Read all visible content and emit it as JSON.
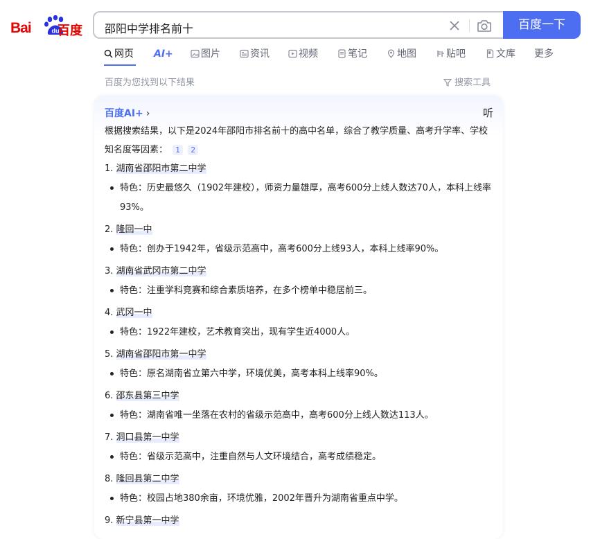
{
  "logo": {
    "bai": "Bai",
    "du": "du",
    "baidu": "百度"
  },
  "search": {
    "query": "邵阳中学排名前十",
    "button": "百度一下"
  },
  "tabs": [
    {
      "label": "网页"
    },
    {
      "label": "AI+"
    },
    {
      "label": "图片"
    },
    {
      "label": "资讯"
    },
    {
      "label": "视频"
    },
    {
      "label": "笔记"
    },
    {
      "label": "地图"
    },
    {
      "label": "贴吧"
    },
    {
      "label": "文库"
    },
    {
      "label": "更多"
    }
  ],
  "result_count": "百度为您找到以下结果",
  "search_tools": "搜索工具",
  "ai": {
    "brand": "百度AI+",
    "listen": "听",
    "intro": "根据搜索结果，以下是2024年邵阳市排名前十的高中名单，综合了教学质量、高考升学率、学校知名度等因素：",
    "refs": [
      "1",
      "2"
    ],
    "items": [
      {
        "num": "1.",
        "name": "湖南省邵阳市第二中学",
        "feat": "特色：历史最悠久（1902年建校），师资力量雄厚，高考600分上线人数达70人，本科上线率93%。"
      },
      {
        "num": "2.",
        "name": "隆回一中",
        "feat": "特色：创办于1942年，省级示范高中，高考600分上线93人，本科上线率90%。"
      },
      {
        "num": "3.",
        "name": "湖南省武冈市第二中学",
        "feat": "特色：注重学科竞赛和综合素质培养，在多个榜单中稳居前三。"
      },
      {
        "num": "4.",
        "name": "武冈一中",
        "feat": "特色：1922年建校，艺术教育突出，现有学生近4000人。"
      },
      {
        "num": "5.",
        "name": "湖南省邵阳市第一中学",
        "feat": "特色：原名湖南省立第六中学，环境优美，高考本科上线率90%。"
      },
      {
        "num": "6.",
        "name": "邵东县第三中学",
        "feat": "特色：湖南省唯一坐落在农村的省级示范高中，高考600分上线人数达113人。"
      },
      {
        "num": "7.",
        "name": "洞口县第一中学",
        "feat": "特色：省级示范高中，注重自然与人文环境结合，高考成绩稳定。"
      },
      {
        "num": "8.",
        "name": "隆回县第二中学",
        "feat": "特色：校园占地380余亩，环境优雅，2002年晋升为湖南省重点中学。"
      },
      {
        "num": "9.",
        "name": "新宁县第一中学",
        "feat": ""
      }
    ]
  },
  "colors": {
    "brand_red": "#e10601",
    "brand_blue": "#4e6ef2"
  }
}
